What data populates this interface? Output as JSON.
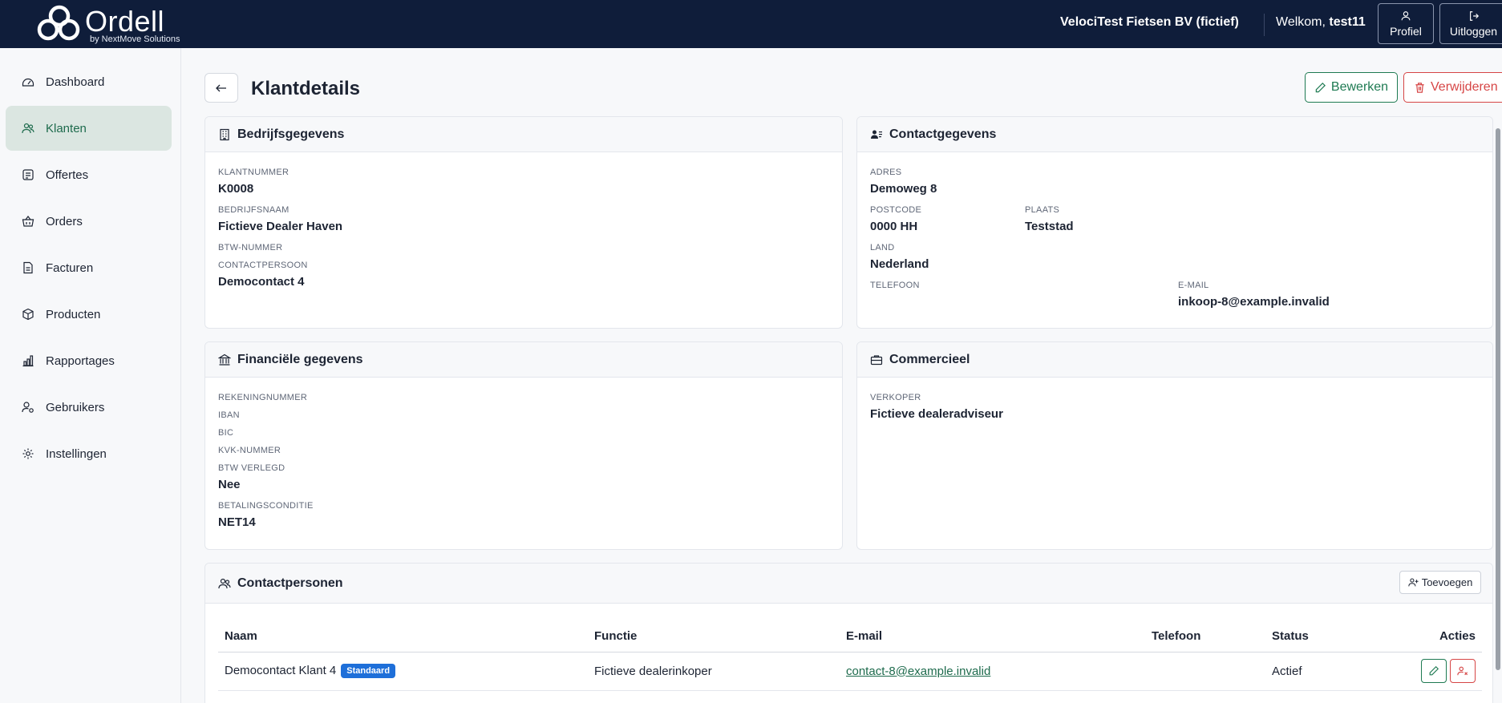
{
  "header": {
    "brand": "Ordell",
    "brand_sub": "by NextMove Solutions",
    "company": "VelociTest Fietsen BV (fictief)",
    "welcome_prefix": "Welkom, ",
    "user": "test11",
    "profile_label": "Profiel",
    "logout_label": "Uitloggen"
  },
  "sidebar": {
    "items": [
      {
        "label": "Dashboard",
        "icon": "dashboard-icon"
      },
      {
        "label": "Klanten",
        "icon": "users-icon",
        "active": true
      },
      {
        "label": "Offertes",
        "icon": "list-icon"
      },
      {
        "label": "Orders",
        "icon": "basket-icon"
      },
      {
        "label": "Facturen",
        "icon": "file-icon"
      },
      {
        "label": "Producten",
        "icon": "box-icon"
      },
      {
        "label": "Rapportages",
        "icon": "bar-chart-icon"
      },
      {
        "label": "Gebruikers",
        "icon": "user-gear-icon"
      },
      {
        "label": "Instellingen",
        "icon": "gear-icon"
      }
    ]
  },
  "page": {
    "title": "Klantdetails",
    "edit_label": "Bewerken",
    "delete_label": "Verwijderen"
  },
  "company_card": {
    "title": "Bedrijfsgegevens",
    "klantnummer_label": "Klantnummer",
    "klantnummer": "K0008",
    "bedrijfsnaam_label": "Bedrijfsnaam",
    "bedrijfsnaam": "Fictieve Dealer Haven",
    "btw_label": "BTW-nummer",
    "btw": "",
    "contactpersoon_label": "Contactpersoon",
    "contactpersoon": "Democontact 4"
  },
  "contact_card": {
    "title": "Contactgegevens",
    "adres_label": "Adres",
    "adres": "Demoweg 8",
    "postcode_label": "Postcode",
    "postcode": "0000 HH",
    "plaats_label": "Plaats",
    "plaats": "Teststad",
    "land_label": "Land",
    "land": "Nederland",
    "telefoon_label": "Telefoon",
    "telefoon": "",
    "email_label": "E-mail",
    "email": "inkoop-8@example.invalid"
  },
  "finance_card": {
    "title": "Financiële gegevens",
    "rekening_label": "Rekeningnummer",
    "iban_label": "IBAN",
    "bic_label": "BIC",
    "kvk_label": "KVK-nummer",
    "btw_verlegd_label": "BTW verlegd",
    "btw_verlegd": "Nee",
    "betaling_label": "Betalingsconditie",
    "betaling": "NET14"
  },
  "commercial_card": {
    "title": "Commercieel",
    "verkoper_label": "Verkoper",
    "verkoper": "Fictieve dealeradviseur"
  },
  "contacts_card": {
    "title": "Contactpersonen",
    "add_label": "Toevoegen",
    "columns": [
      "Naam",
      "Functie",
      "E-mail",
      "Telefoon",
      "Status",
      "Acties"
    ],
    "rows": [
      {
        "naam": "Democontact Klant 4",
        "badge": "Standaard",
        "functie": "Fictieve dealerinkoper",
        "email": "contact-8@example.invalid",
        "telefoon": "",
        "status": "Actief"
      }
    ]
  },
  "colors": {
    "topbar": "#0f1d3a",
    "accent": "#1e7a52",
    "danger": "#d64545",
    "badge": "#1e6fd9"
  }
}
